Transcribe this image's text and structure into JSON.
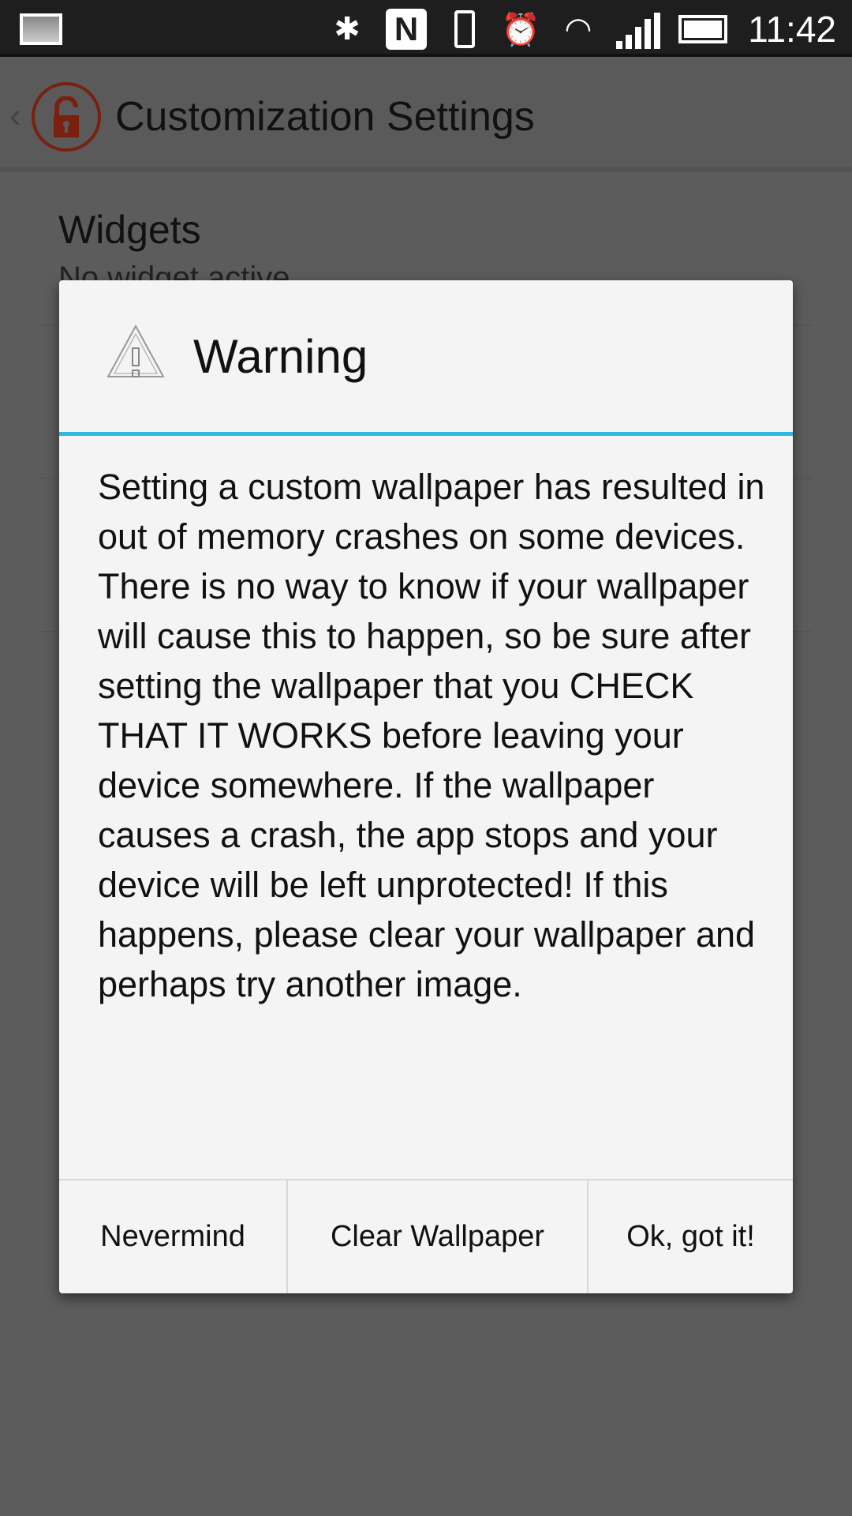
{
  "status_bar": {
    "time": "11:42",
    "icons": [
      "gallery-notification-icon",
      "bluetooth-icon",
      "nfc-icon",
      "vibrate-icon",
      "alarm-icon",
      "wifi-icon",
      "signal-icon",
      "battery-icon"
    ]
  },
  "action_bar": {
    "title": "Customization Settings",
    "logo_color": "#7a2010"
  },
  "preferences": [
    {
      "title": "Widgets",
      "summary": "No widget active"
    }
  ],
  "dialog": {
    "title": "Warning",
    "accent": "#33b5e5",
    "message": "Setting a custom wallpaper has resulted in out of memory crashes on some devices. There is no way to know if your wallpaper will cause this to happen, so be sure after setting the wallpaper that you CHECK THAT IT WORKS before leaving your device somewhere. If the wallpaper causes a crash, the app stops and your device will be left unprotected! If this happens, please clear your wallpaper and perhaps try another image.",
    "buttons": [
      "Nevermind",
      "Clear Wallpaper",
      "Ok, got it!"
    ]
  }
}
